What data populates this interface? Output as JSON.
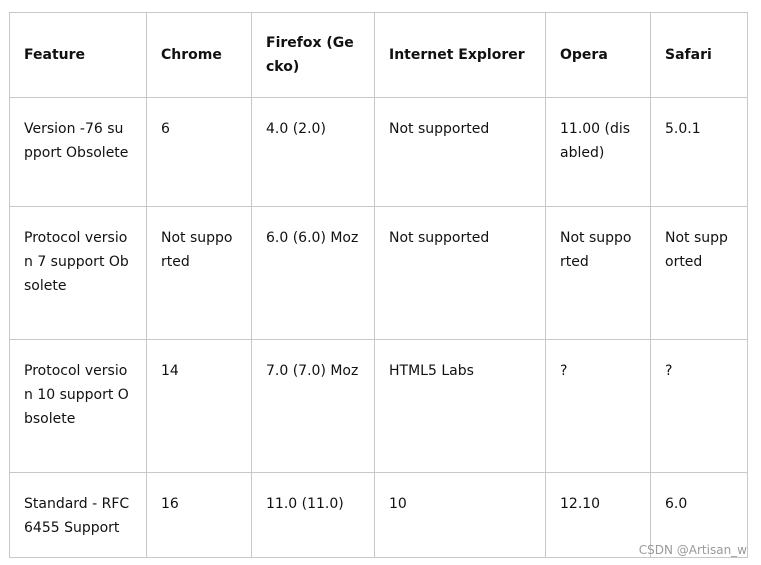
{
  "table": {
    "headers": [
      "Feature",
      "Chrome",
      "Firefox (Gecko)",
      "Internet Explorer",
      "Opera",
      "Safari"
    ],
    "rows": [
      [
        "Version -76 support Obsolete",
        "6",
        "4.0 (2.0)",
        "Not supported",
        "11.00 (disabled)",
        "5.0.1"
      ],
      [
        "Protocol version 7 support Obsolete",
        "Not supported",
        "6.0 (6.0) Moz",
        "Not supported",
        "Not supported",
        "Not supported"
      ],
      [
        "Protocol version 10 support Obsolete",
        "14",
        "7.0 (7.0) Moz",
        "HTML5 Labs",
        "?",
        "?"
      ],
      [
        "Standard - RFC 6455 Support",
        "16",
        "11.0 (11.0)",
        "10",
        "12.10",
        "6.0"
      ]
    ]
  },
  "watermark": "CSDN @Artisan_w"
}
